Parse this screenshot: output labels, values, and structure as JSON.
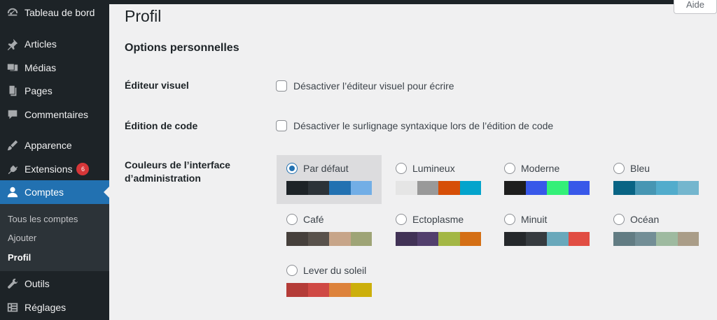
{
  "sidebar": {
    "items": [
      {
        "id": "dashboard",
        "label": "Tableau de bord",
        "icon": "gauge-icon"
      },
      {
        "id": "posts",
        "label": "Articles",
        "icon": "pin-icon"
      },
      {
        "id": "media",
        "label": "Médias",
        "icon": "media-icon"
      },
      {
        "id": "pages",
        "label": "Pages",
        "icon": "page-icon"
      },
      {
        "id": "comments",
        "label": "Commentaires",
        "icon": "comment-icon"
      },
      {
        "id": "appearance",
        "label": "Apparence",
        "icon": "brush-icon"
      },
      {
        "id": "plugins",
        "label": "Extensions",
        "icon": "plug-icon",
        "badge": "6"
      },
      {
        "id": "users",
        "label": "Comptes",
        "icon": "user-icon"
      },
      {
        "id": "tools",
        "label": "Outils",
        "icon": "wrench-icon"
      },
      {
        "id": "settings",
        "label": "Réglages",
        "icon": "settings-icon"
      }
    ],
    "submenu": [
      "Tous les comptes",
      "Ajouter",
      "Profil"
    ]
  },
  "header": {
    "help_label": "Aide",
    "title": "Profil"
  },
  "section_title": "Options personnelles",
  "visual_editor": {
    "label": "Éditeur visuel",
    "checkbox_label": "Désactiver l’éditeur visuel pour écrire",
    "checked": false
  },
  "code_editing": {
    "label": "Édition de code",
    "checkbox_label": "Désactiver le surlignage syntaxique lors de l’édition de code",
    "checked": false
  },
  "admin_colors": {
    "label_line1": "Couleurs de l’interface",
    "label_line2": "d’administration",
    "selected": "Par défaut",
    "schemes": [
      {
        "name": "Par défaut",
        "colors": [
          "#1d2327",
          "#2c3338",
          "#2271b1",
          "#72aee6"
        ]
      },
      {
        "name": "Lumineux",
        "colors": [
          "#e5e5e5",
          "#999999",
          "#d64e07",
          "#04a4cc"
        ]
      },
      {
        "name": "Moderne",
        "colors": [
          "#1e1e1e",
          "#3858e9",
          "#33f078",
          "#3858e9"
        ]
      },
      {
        "name": "Bleu",
        "colors": [
          "#096484",
          "#4796b3",
          "#52accc",
          "#74b6ce"
        ]
      },
      {
        "name": "Café",
        "colors": [
          "#46403c",
          "#59524c",
          "#c7a589",
          "#9ea476"
        ]
      },
      {
        "name": "Ectoplasme",
        "colors": [
          "#413256",
          "#523f6d",
          "#a3b745",
          "#d46f15"
        ]
      },
      {
        "name": "Minuit",
        "colors": [
          "#25282b",
          "#363b3f",
          "#69a8bb",
          "#e14d43"
        ]
      },
      {
        "name": "Océan",
        "colors": [
          "#627c83",
          "#738e96",
          "#9ebaa0",
          "#aa9d88"
        ]
      },
      {
        "name": "Lever du soleil",
        "colors": [
          "#b43c38",
          "#cf4944",
          "#dd823b",
          "#ccaf0b"
        ]
      }
    ]
  }
}
